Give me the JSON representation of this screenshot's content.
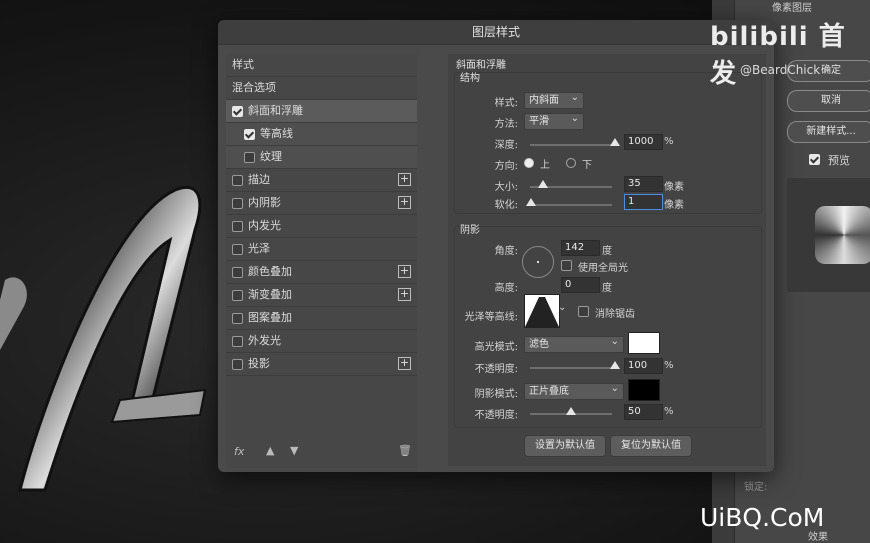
{
  "dialog": {
    "title": "图层样式"
  },
  "style_list": {
    "header": "样式",
    "blend_options": "混合选项",
    "items": [
      {
        "label": "斜面和浮雕",
        "checked": true,
        "selected": true
      },
      {
        "label": "等高线",
        "checked": true,
        "sub": true
      },
      {
        "label": "纹理",
        "checked": false,
        "sub": true
      },
      {
        "label": "描边",
        "checked": false,
        "plus": true
      },
      {
        "label": "内阴影",
        "checked": false,
        "plus": true
      },
      {
        "label": "内发光",
        "checked": false
      },
      {
        "label": "光泽",
        "checked": false
      },
      {
        "label": "颜色叠加",
        "checked": false,
        "plus": true
      },
      {
        "label": "渐变叠加",
        "checked": false,
        "plus": true
      },
      {
        "label": "图案叠加",
        "checked": false
      },
      {
        "label": "外发光",
        "checked": false
      },
      {
        "label": "投影",
        "checked": false,
        "plus": true
      }
    ],
    "footer_fx": "fx"
  },
  "bevel": {
    "section_title": "斜面和浮雕",
    "structure_title": "结构",
    "style_label": "样式:",
    "style_value": "内斜面",
    "technique_label": "方法:",
    "technique_value": "平滑",
    "depth_label": "深度:",
    "depth_value": "1000",
    "depth_unit": "%",
    "direction_label": "方向:",
    "direction_up": "上",
    "direction_down": "下",
    "size_label": "大小:",
    "size_value": "35",
    "size_unit": "像素",
    "soften_label": "软化:",
    "soften_value": "1",
    "soften_unit": "像素"
  },
  "shading": {
    "title": "阴影",
    "angle_label": "角度:",
    "angle_value": "142",
    "angle_unit": "度",
    "global_light_label": "使用全局光",
    "altitude_label": "高度:",
    "altitude_value": "0",
    "altitude_unit": "度",
    "gloss_contour_label": "光泽等高线:",
    "antialias_label": "消除锯齿",
    "highlight_mode_label": "高光模式:",
    "highlight_mode_value": "滤色",
    "highlight_color": "#ffffff",
    "highlight_opacity_label": "不透明度:",
    "highlight_opacity_value": "100",
    "highlight_opacity_unit": "%",
    "shadow_mode_label": "阴影模式:",
    "shadow_mode_value": "正片叠底",
    "shadow_color": "#000000",
    "shadow_opacity_label": "不透明度:",
    "shadow_opacity_value": "50",
    "shadow_opacity_unit": "%"
  },
  "bottom_buttons": {
    "make_default": "设置为默认值",
    "reset_default": "复位为默认值"
  },
  "right_buttons": {
    "ok": "确定",
    "cancel": "取消",
    "new_style": "新建样式...",
    "preview": "预览"
  },
  "app": {
    "layer_label": "像素图层",
    "lock_label": "锁定:",
    "effects_label": "效果"
  },
  "watermarks": {
    "top": "bilibili 首发",
    "handle": "@BeardChick",
    "bottom": "UiBQ.CoM"
  }
}
